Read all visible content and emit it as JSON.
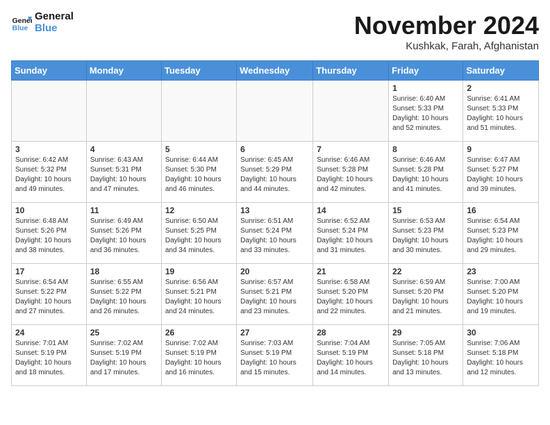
{
  "header": {
    "logo_line1": "General",
    "logo_line2": "Blue",
    "month": "November 2024",
    "location": "Kushkak, Farah, Afghanistan"
  },
  "weekdays": [
    "Sunday",
    "Monday",
    "Tuesday",
    "Wednesday",
    "Thursday",
    "Friday",
    "Saturday"
  ],
  "weeks": [
    [
      {
        "day": "",
        "info": ""
      },
      {
        "day": "",
        "info": ""
      },
      {
        "day": "",
        "info": ""
      },
      {
        "day": "",
        "info": ""
      },
      {
        "day": "",
        "info": ""
      },
      {
        "day": "1",
        "info": "Sunrise: 6:40 AM\nSunset: 5:33 PM\nDaylight: 10 hours\nand 52 minutes."
      },
      {
        "day": "2",
        "info": "Sunrise: 6:41 AM\nSunset: 5:33 PM\nDaylight: 10 hours\nand 51 minutes."
      }
    ],
    [
      {
        "day": "3",
        "info": "Sunrise: 6:42 AM\nSunset: 5:32 PM\nDaylight: 10 hours\nand 49 minutes."
      },
      {
        "day": "4",
        "info": "Sunrise: 6:43 AM\nSunset: 5:31 PM\nDaylight: 10 hours\nand 47 minutes."
      },
      {
        "day": "5",
        "info": "Sunrise: 6:44 AM\nSunset: 5:30 PM\nDaylight: 10 hours\nand 46 minutes."
      },
      {
        "day": "6",
        "info": "Sunrise: 6:45 AM\nSunset: 5:29 PM\nDaylight: 10 hours\nand 44 minutes."
      },
      {
        "day": "7",
        "info": "Sunrise: 6:46 AM\nSunset: 5:28 PM\nDaylight: 10 hours\nand 42 minutes."
      },
      {
        "day": "8",
        "info": "Sunrise: 6:46 AM\nSunset: 5:28 PM\nDaylight: 10 hours\nand 41 minutes."
      },
      {
        "day": "9",
        "info": "Sunrise: 6:47 AM\nSunset: 5:27 PM\nDaylight: 10 hours\nand 39 minutes."
      }
    ],
    [
      {
        "day": "10",
        "info": "Sunrise: 6:48 AM\nSunset: 5:26 PM\nDaylight: 10 hours\nand 38 minutes."
      },
      {
        "day": "11",
        "info": "Sunrise: 6:49 AM\nSunset: 5:26 PM\nDaylight: 10 hours\nand 36 minutes."
      },
      {
        "day": "12",
        "info": "Sunrise: 6:50 AM\nSunset: 5:25 PM\nDaylight: 10 hours\nand 34 minutes."
      },
      {
        "day": "13",
        "info": "Sunrise: 6:51 AM\nSunset: 5:24 PM\nDaylight: 10 hours\nand 33 minutes."
      },
      {
        "day": "14",
        "info": "Sunrise: 6:52 AM\nSunset: 5:24 PM\nDaylight: 10 hours\nand 31 minutes."
      },
      {
        "day": "15",
        "info": "Sunrise: 6:53 AM\nSunset: 5:23 PM\nDaylight: 10 hours\nand 30 minutes."
      },
      {
        "day": "16",
        "info": "Sunrise: 6:54 AM\nSunset: 5:23 PM\nDaylight: 10 hours\nand 29 minutes."
      }
    ],
    [
      {
        "day": "17",
        "info": "Sunrise: 6:54 AM\nSunset: 5:22 PM\nDaylight: 10 hours\nand 27 minutes."
      },
      {
        "day": "18",
        "info": "Sunrise: 6:55 AM\nSunset: 5:22 PM\nDaylight: 10 hours\nand 26 minutes."
      },
      {
        "day": "19",
        "info": "Sunrise: 6:56 AM\nSunset: 5:21 PM\nDaylight: 10 hours\nand 24 minutes."
      },
      {
        "day": "20",
        "info": "Sunrise: 6:57 AM\nSunset: 5:21 PM\nDaylight: 10 hours\nand 23 minutes."
      },
      {
        "day": "21",
        "info": "Sunrise: 6:58 AM\nSunset: 5:20 PM\nDaylight: 10 hours\nand 22 minutes."
      },
      {
        "day": "22",
        "info": "Sunrise: 6:59 AM\nSunset: 5:20 PM\nDaylight: 10 hours\nand 21 minutes."
      },
      {
        "day": "23",
        "info": "Sunrise: 7:00 AM\nSunset: 5:20 PM\nDaylight: 10 hours\nand 19 minutes."
      }
    ],
    [
      {
        "day": "24",
        "info": "Sunrise: 7:01 AM\nSunset: 5:19 PM\nDaylight: 10 hours\nand 18 minutes."
      },
      {
        "day": "25",
        "info": "Sunrise: 7:02 AM\nSunset: 5:19 PM\nDaylight: 10 hours\nand 17 minutes."
      },
      {
        "day": "26",
        "info": "Sunrise: 7:02 AM\nSunset: 5:19 PM\nDaylight: 10 hours\nand 16 minutes."
      },
      {
        "day": "27",
        "info": "Sunrise: 7:03 AM\nSunset: 5:19 PM\nDaylight: 10 hours\nand 15 minutes."
      },
      {
        "day": "28",
        "info": "Sunrise: 7:04 AM\nSunset: 5:19 PM\nDaylight: 10 hours\nand 14 minutes."
      },
      {
        "day": "29",
        "info": "Sunrise: 7:05 AM\nSunset: 5:18 PM\nDaylight: 10 hours\nand 13 minutes."
      },
      {
        "day": "30",
        "info": "Sunrise: 7:06 AM\nSunset: 5:18 PM\nDaylight: 10 hours\nand 12 minutes."
      }
    ]
  ]
}
